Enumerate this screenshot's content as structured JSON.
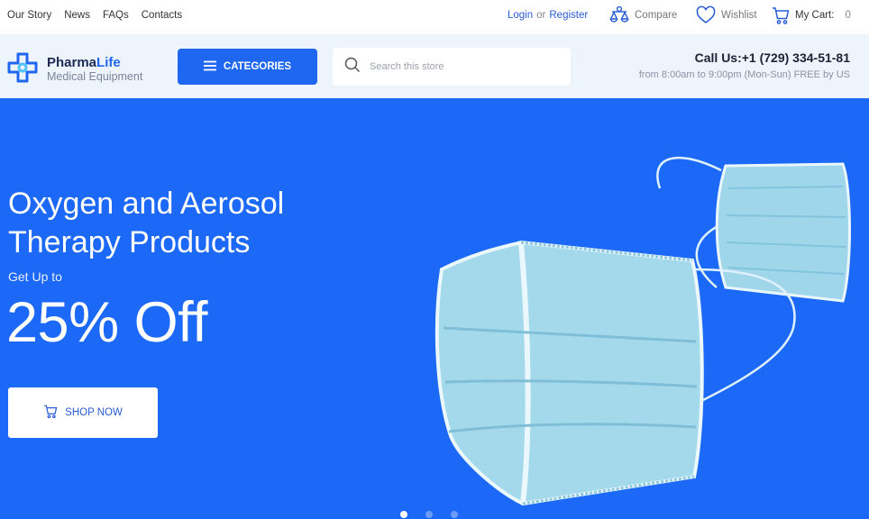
{
  "topbar": {
    "nav": [
      "Our Story",
      "News",
      "FAQs",
      "Contacts"
    ],
    "login": "Login",
    "or": "or",
    "register": "Register",
    "compare": "Compare",
    "wishlist": "Wishlist",
    "cart_label": "My Cart:",
    "cart_count": "0"
  },
  "header": {
    "logo_name_a": "Pharma",
    "logo_name_b": "Life",
    "logo_sub": "Medical Equipment",
    "categories_label": "CATEGORIES",
    "search_placeholder": "Search this store",
    "call_main": "Call Us:+1 (729) 334-51-81",
    "call_sub": "from 8:00am to 9:00pm (Mon-Sun) FREE by US"
  },
  "hero": {
    "title": "Oxygen and Aerosol Therapy Products",
    "subtitle": "Get Up to",
    "discount": "25% Off",
    "button_label": "SHOP NOW",
    "slides": 3,
    "active_slide": 1
  },
  "colors": {
    "accent": "#1f66f0",
    "hero_bg": "#1c68f7",
    "header_bg": "#eef4fc"
  },
  "icons": [
    "compare-icon",
    "heart-icon",
    "cart-icon",
    "menu-icon",
    "search-icon",
    "logo-icon",
    "shop-cart-icon"
  ]
}
